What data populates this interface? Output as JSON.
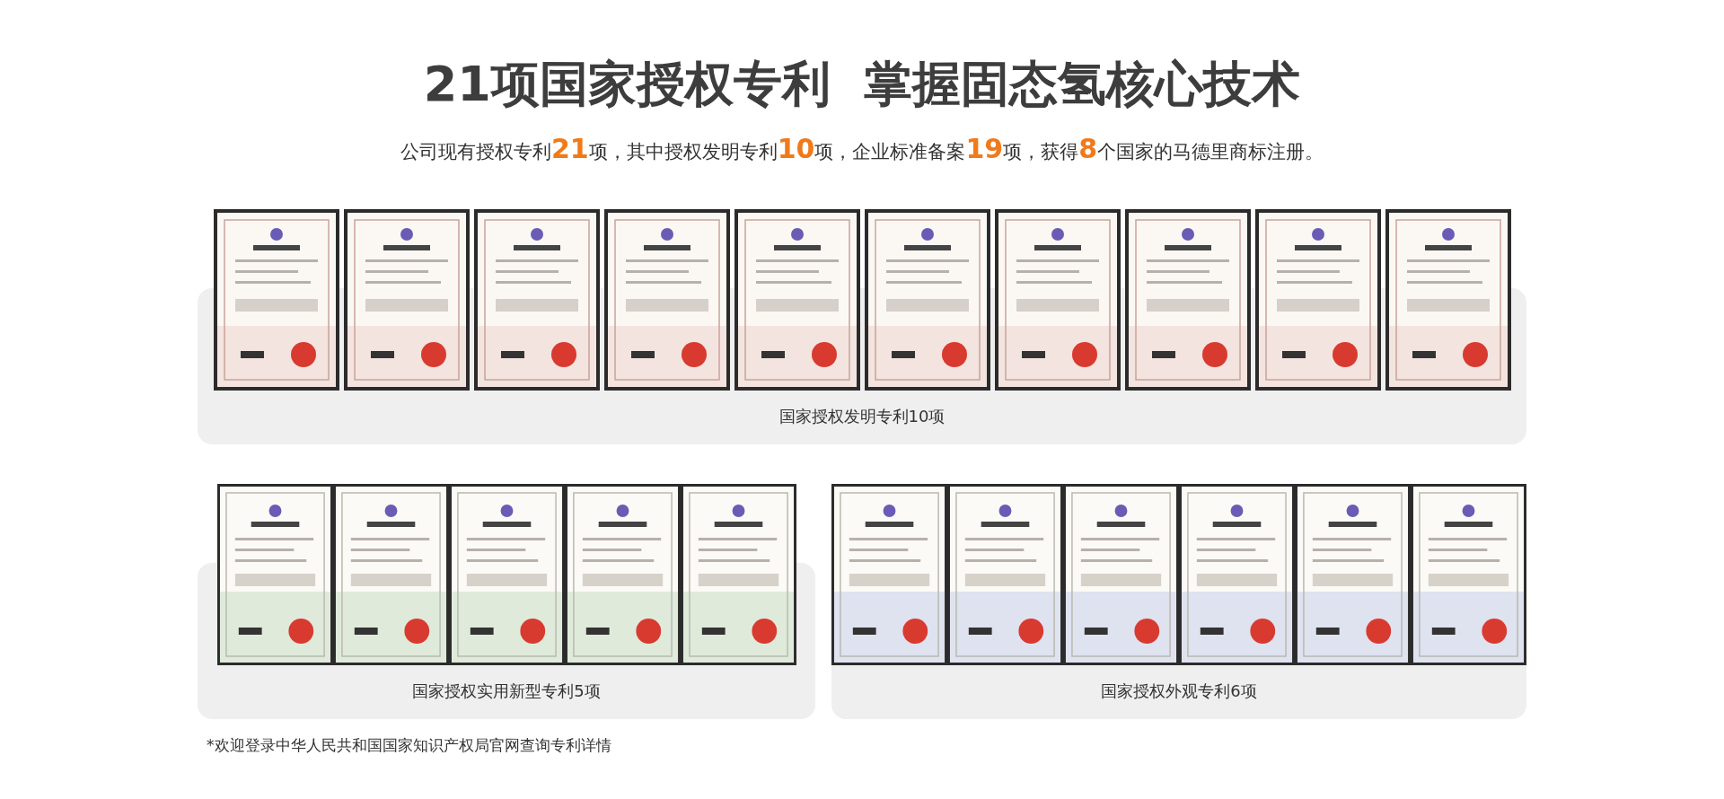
{
  "header": {
    "title": "21项国家授权专利  掌握固态氢核心技术",
    "subtitle": "公司现有授权专利**21**项，其中授权发明专利**10**项，企业标准备案**19**项，获得**8**个国家的马德里商标注册。"
  },
  "top_group": {
    "caption": "国家授权发明专利10项"
  },
  "bottom_groups": [
    {
      "caption": "国家授权实用新型专利5项"
    },
    {
      "caption": "国家授权外观专利6项"
    }
  ],
  "footnote": "*欢迎登录中华人民共和国国家知识产权局官网查询专利详情"
}
